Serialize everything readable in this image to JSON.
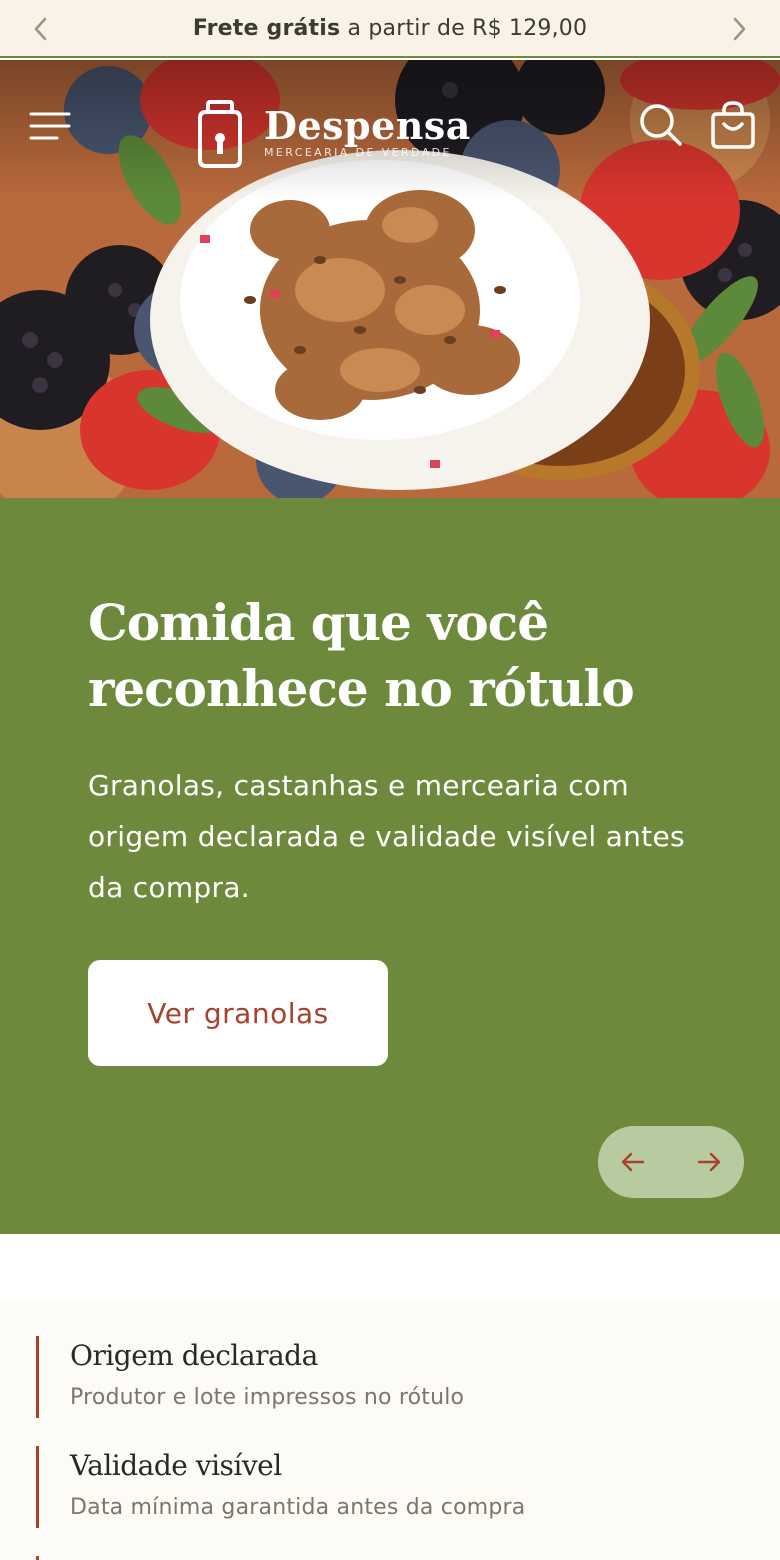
{
  "announcement": {
    "bold_text": "Frete grátis",
    "text": " a partir de R$ 129,00",
    "prev_icon": "chevron-left-icon",
    "next_icon": "chevron-right-icon"
  },
  "header": {
    "brand_name": "Despensa",
    "brand_tagline": "MERCEARIA DE VERDADE",
    "menu_icon": "menu-icon",
    "search_icon": "search-icon",
    "cart_icon": "shopping-bag-icon"
  },
  "hero": {
    "title": "Comida que você reconhece no rótulo",
    "description": "Granolas, castanhas e mercearia com origem declarada e validade visível antes da compra.",
    "cta_label": "Ver granolas",
    "prev_icon": "arrow-left-icon",
    "next_icon": "arrow-right-icon"
  },
  "features": [
    {
      "title": "Origem declarada",
      "subtitle": "Produtor e lote impressos no rótulo"
    },
    {
      "title": "Validade visível",
      "subtitle": "Data mínima garantida antes da compra"
    },
    {
      "title": "",
      "subtitle": ""
    }
  ],
  "colors": {
    "announcement_bg": "#f8f2e7",
    "brand_green": "#6d8a3c",
    "accent_red": "#a8412e",
    "pager_bg": "#b8cba0",
    "features_bg": "#fdfbf6"
  }
}
